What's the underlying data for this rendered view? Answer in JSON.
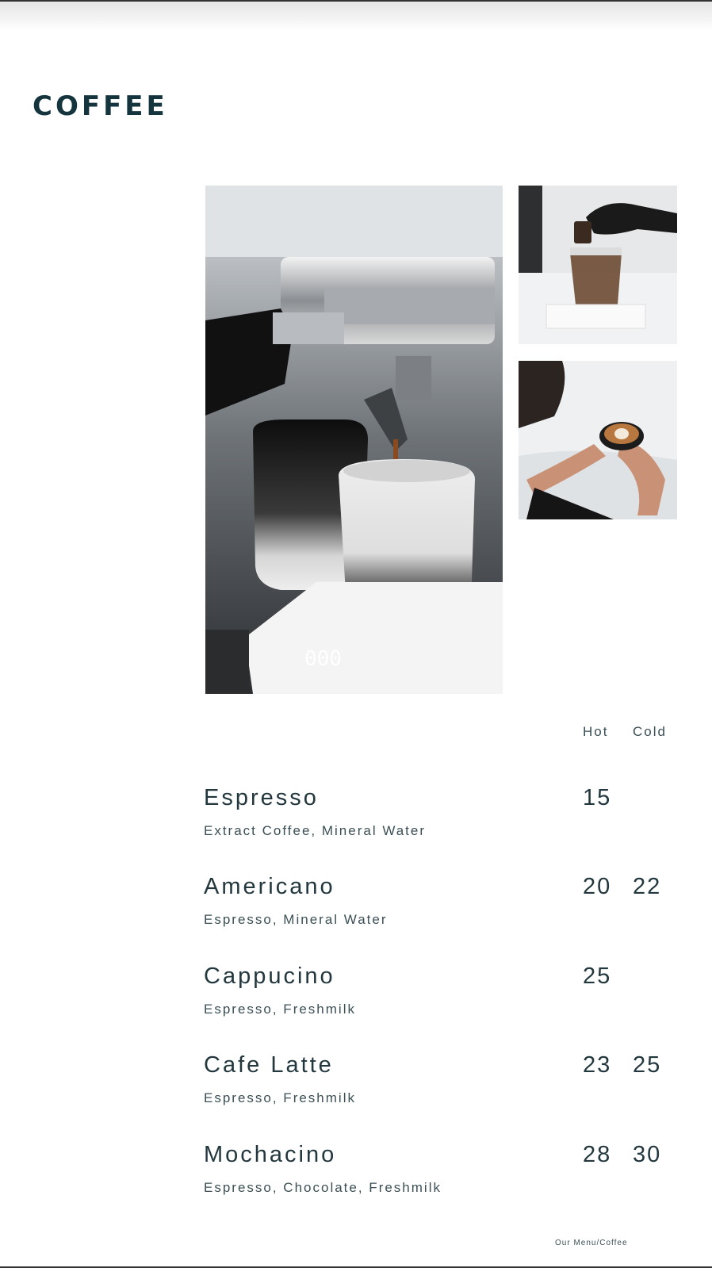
{
  "page": {
    "title": "COFFEE",
    "footer": "Our Menu/Coffee"
  },
  "columns": {
    "hot": "Hot",
    "cold": "Cold"
  },
  "photos": [
    {
      "name": "espresso-extraction-photo"
    },
    {
      "name": "iced-coffee-pour-photo"
    },
    {
      "name": "latte-art-photo"
    }
  ],
  "menu": [
    {
      "name": "Espresso",
      "description": "Extract Coffee, Mineral Water",
      "hot": "15",
      "cold": ""
    },
    {
      "name": "Americano",
      "description": "Espresso, Mineral Water",
      "hot": "20",
      "cold": "22"
    },
    {
      "name": "Cappucino",
      "description": "Espresso, Freshmilk",
      "hot": "25",
      "cold": ""
    },
    {
      "name": "Cafe Latte",
      "description": "Espresso, Freshmilk",
      "hot": "23",
      "cold": "25"
    },
    {
      "name": "Mochacino",
      "description": "Espresso, Chocolate, Freshmilk",
      "hot": "28",
      "cold": "30"
    }
  ]
}
